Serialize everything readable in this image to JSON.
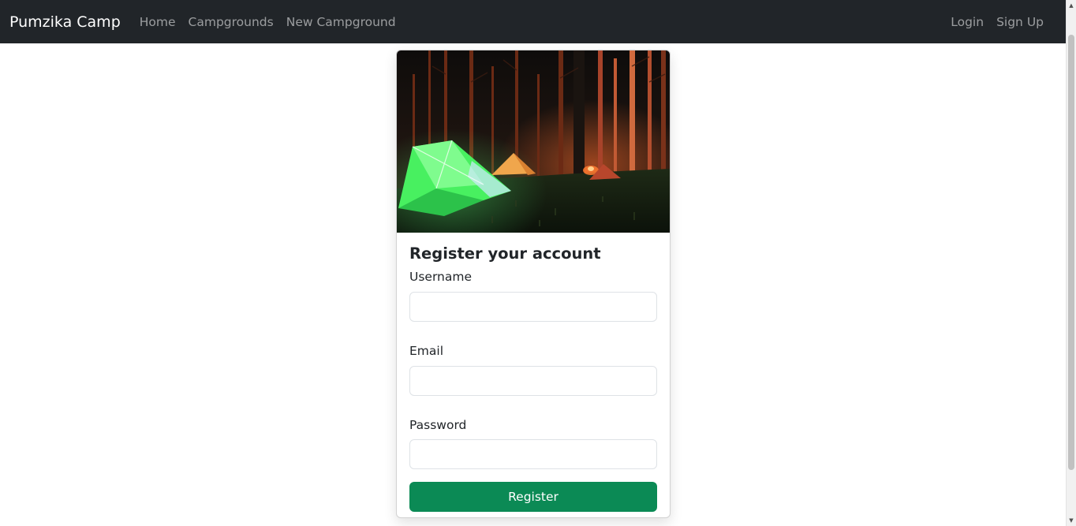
{
  "navbar": {
    "brand": "Pumzika Camp",
    "links": [
      "Home",
      "Campgrounds",
      "New Campground"
    ],
    "right_links": [
      "Login",
      "Sign Up"
    ]
  },
  "card": {
    "image_alt": "Tents lit up at night in a forest campground",
    "title": "Register your account",
    "fields": [
      {
        "label": "Username",
        "value": "",
        "placeholder": ""
      },
      {
        "label": "Email",
        "value": "",
        "placeholder": ""
      },
      {
        "label": "Password",
        "value": "",
        "placeholder": ""
      }
    ],
    "submit_label": "Register"
  },
  "colors": {
    "navbar_bg": "#212529",
    "button_bg": "#0b8a55",
    "tent_green": "#39ff6a"
  }
}
